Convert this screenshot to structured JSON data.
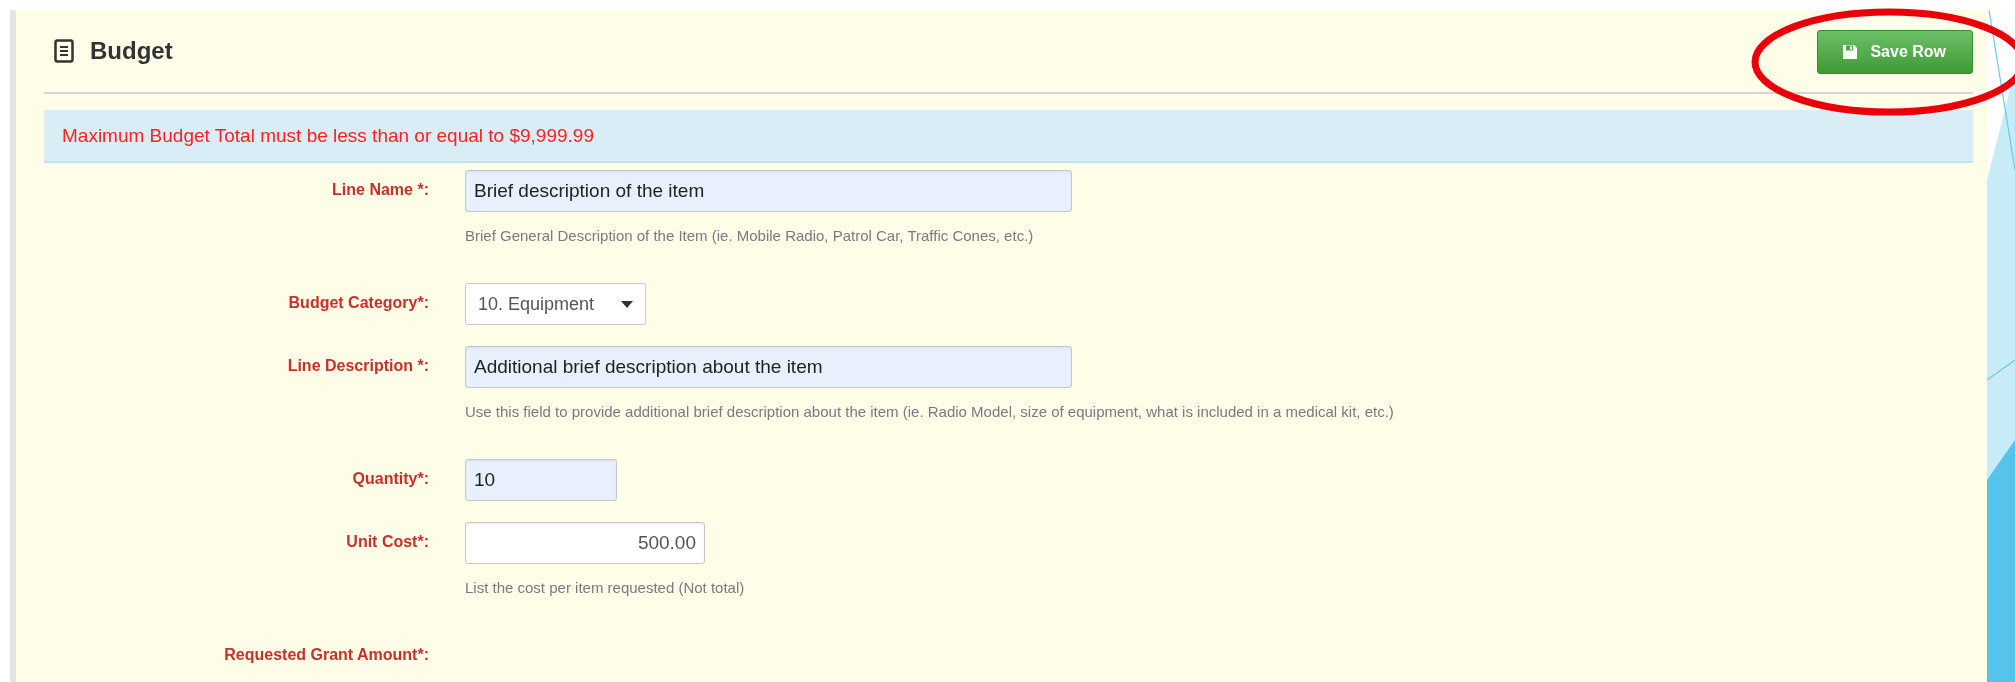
{
  "section": {
    "title": "Budget",
    "save_button": "Save Row"
  },
  "alert": "Maximum Budget Total must be less than or equal to $9,999.99",
  "fields": [
    {
      "kind": "text",
      "label": "Line Name *:",
      "value": "Brief description of the item",
      "autofilled": true,
      "help": "Brief General Description of the Item (ie. Mobile Radio, Patrol Car, Traffic Cones, etc.)"
    },
    {
      "kind": "select",
      "label": "Budget Category*:",
      "value": "10. Equipment"
    },
    {
      "kind": "text",
      "label": "Line Description *:",
      "value": "Additional brief description about the item",
      "autofilled": true,
      "help": "Use this field to provide additional brief description about the item (ie. Radio Model, size of equipment, what is included in a medical kit, etc.)"
    },
    {
      "kind": "number",
      "label": "Quantity*:",
      "value": "10",
      "autofilled": true
    },
    {
      "kind": "money",
      "label": "Unit Cost*:",
      "value": "500.00",
      "autofilled": false,
      "help": "List the cost per item requested (Not total)"
    },
    {
      "kind": "empty",
      "label": "Requested Grant Amount*:"
    }
  ]
}
